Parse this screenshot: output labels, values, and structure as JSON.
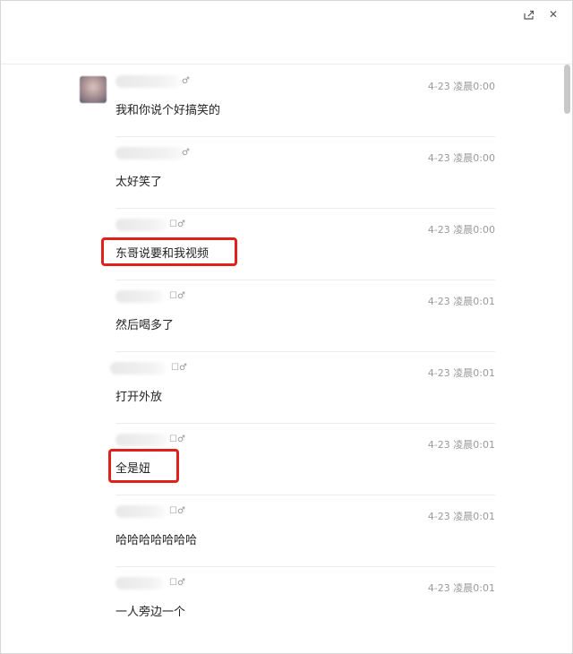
{
  "window": {
    "share_icon": "share-icon",
    "close_glyph": "✕"
  },
  "messages": [
    {
      "sender_tag": "♂",
      "time": "4-23 凌晨0:00",
      "text": "我和你说个好搞笑的"
    },
    {
      "sender_tag": "♂",
      "time": "4-23 凌晨0:00",
      "text": "太好笑了"
    },
    {
      "sender_tag": "☐♂",
      "time": "4-23 凌晨0:00",
      "text": "东哥说要和我视频"
    },
    {
      "sender_tag": "☐♂",
      "time": "4-23 凌晨0:01",
      "text": "然后喝多了"
    },
    {
      "sender_tag": "☐♂",
      "time": "4-23 凌晨0:01",
      "text": "打开外放"
    },
    {
      "sender_tag": "☐♂",
      "time": "4-23 凌晨0:01",
      "text": "全是妞"
    },
    {
      "sender_tag": "☐♂",
      "time": "4-23 凌晨0:01",
      "text": "哈哈哈哈哈哈哈"
    },
    {
      "sender_tag": "☐♂",
      "time": "4-23 凌晨0:01",
      "text": "一人旁边一个"
    }
  ],
  "highlight_color": "#e0211b"
}
